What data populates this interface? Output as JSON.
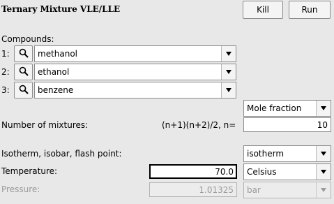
{
  "window": {
    "title": "Ternary Mixture VLE/LLE",
    "kill_label": "Kill",
    "run_label": "Run"
  },
  "compounds": {
    "label": "Compounds:",
    "items": [
      {
        "index": "1:",
        "value": "methanol"
      },
      {
        "index": "2:",
        "value": "ethanol"
      },
      {
        "index": "3:",
        "value": "benzene"
      }
    ]
  },
  "composition": {
    "unit": "Mole fraction"
  },
  "mixtures": {
    "label": "Number of mixtures:",
    "formula": "(n+1)(n+2)/2, n=",
    "n_value": "10"
  },
  "mode": {
    "label": "Isotherm, isobar, flash point:",
    "value": "isotherm"
  },
  "temperature": {
    "label": "Temperature:",
    "value": "70.0",
    "unit": "Celsius"
  },
  "pressure": {
    "label": "Pressure:",
    "value": "1.01325",
    "unit": "bar"
  },
  "icons": {
    "search": "search-icon",
    "dropdown": "chevron-down-icon"
  }
}
